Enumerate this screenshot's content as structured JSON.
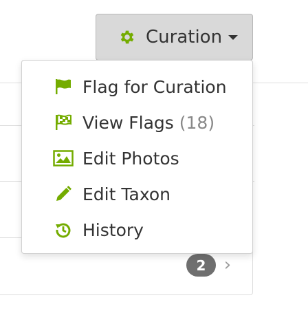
{
  "colors": {
    "accent_green": "#74ac00",
    "text_dark": "#333333",
    "text_muted": "#888888",
    "badge_bg": "#6f6f6f",
    "button_bg": "#d9d9d9"
  },
  "curation_button": {
    "label": "Curation",
    "icon": "gear-icon",
    "caret_icon": "caret-down-icon"
  },
  "menu": {
    "items": [
      {
        "label": "Flag for Curation",
        "icon": "flag-icon"
      },
      {
        "label": "View Flags",
        "count": "(18)",
        "icon": "checkered-flag-icon"
      },
      {
        "label": "Edit Photos",
        "icon": "image-icon"
      },
      {
        "label": "Edit Taxon",
        "icon": "pencil-icon"
      },
      {
        "label": "History",
        "icon": "history-icon"
      }
    ]
  },
  "background": {
    "badge_count": "2",
    "chevron": "›"
  }
}
